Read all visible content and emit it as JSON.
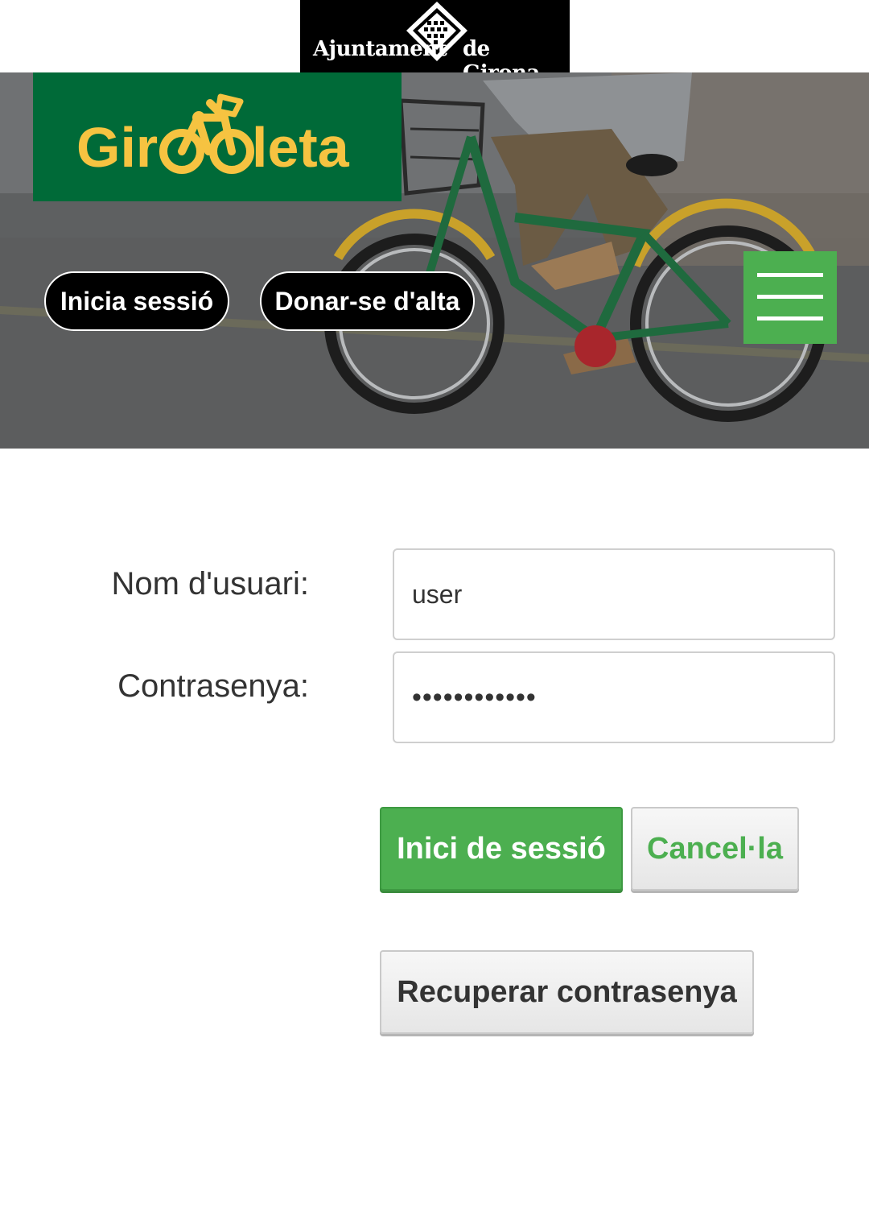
{
  "header": {
    "city_logo": {
      "left_text": "Ajuntament",
      "right_text": "de Girona",
      "icon": "city-seal-icon"
    },
    "brand": {
      "text_prefix": "Gir",
      "text_suffix": "leta",
      "icon": "bicycle-icon",
      "bg_color": "#006a38",
      "text_color": "#f6c341"
    },
    "nav": {
      "login_label": "Inicia sessió",
      "signup_label": "Donar-se d'alta",
      "menu_icon": "hamburger-menu-icon",
      "menu_color": "#4caf50"
    }
  },
  "form": {
    "username_label": "Nom d'usuari:",
    "username_value": "user",
    "password_label": "Contrasenya:",
    "password_value": "••••••••••••",
    "submit_label": "Inici de sessió",
    "cancel_label": "Cancel·la",
    "recover_label": "Recuperar contrasenya",
    "accent_color": "#4caf50"
  }
}
